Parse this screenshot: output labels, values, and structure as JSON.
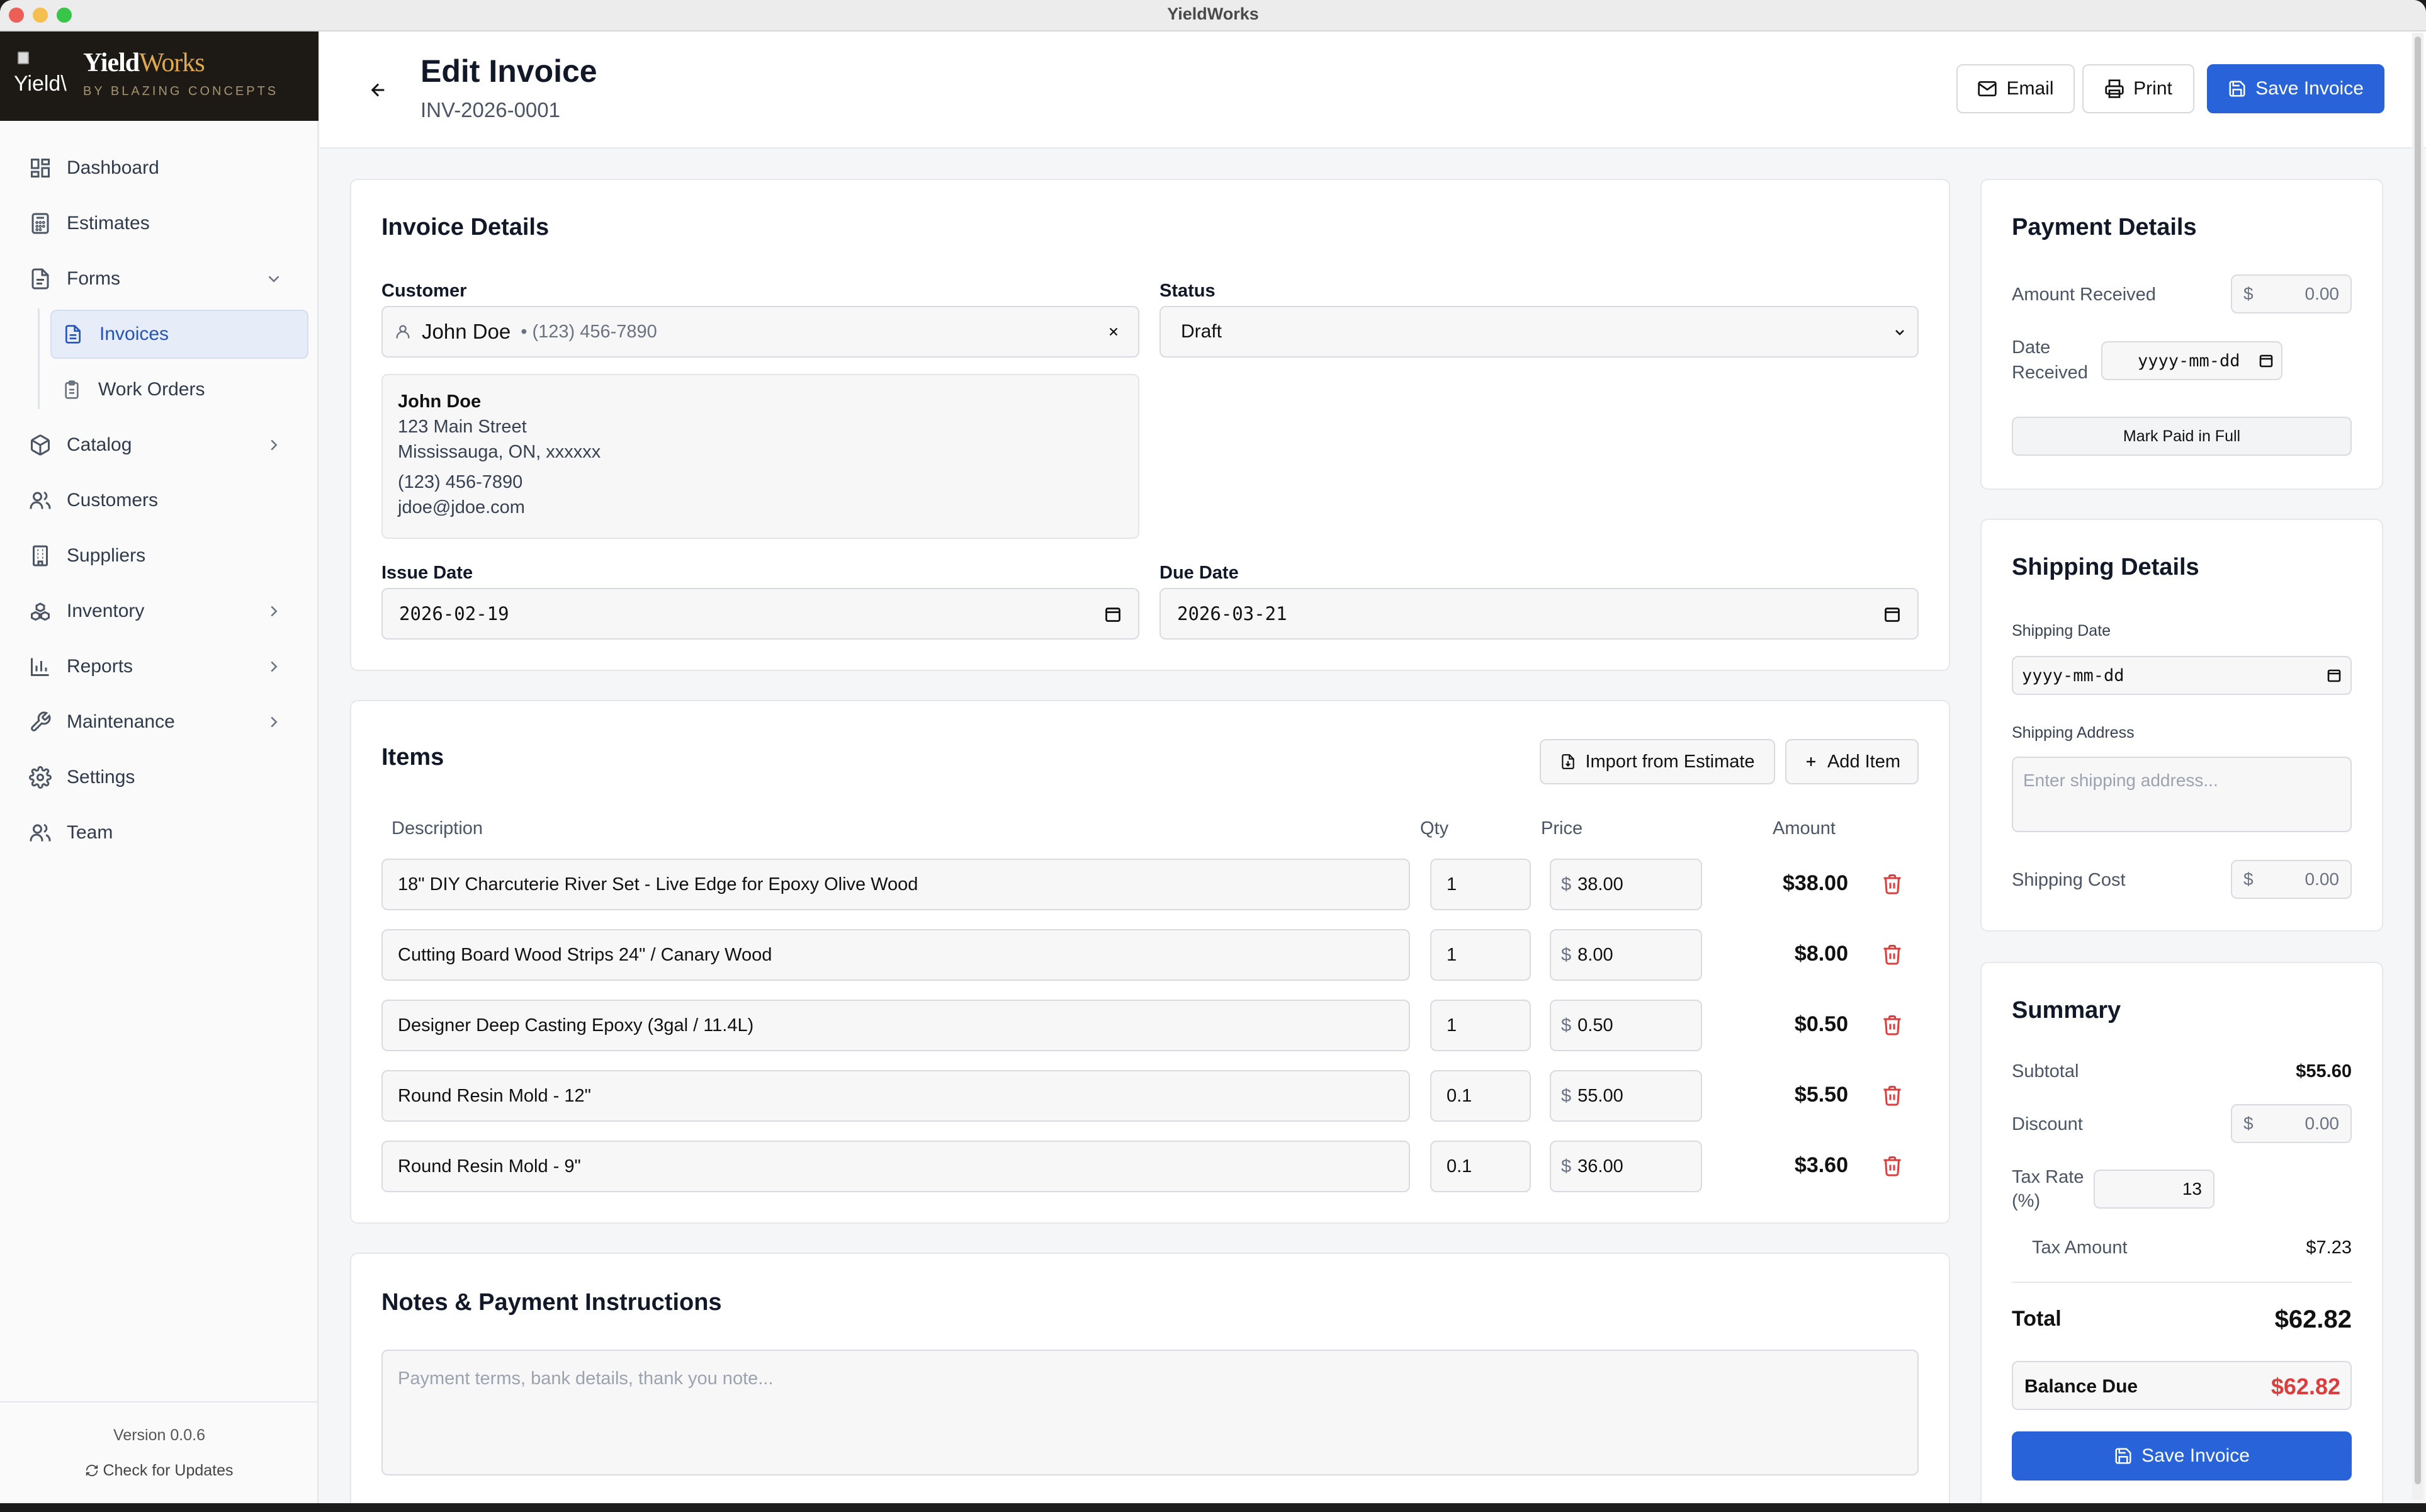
{
  "window": {
    "title": "YieldWorks"
  },
  "brand": {
    "logo_alt": "Yield\\",
    "name_main": "Yield",
    "name_accent": "Works",
    "tagline": "BY BLAZING CONCEPTS"
  },
  "sidebar": {
    "items": [
      {
        "label": "Dashboard",
        "icon": "dashboard-icon"
      },
      {
        "label": "Estimates",
        "icon": "calculator-icon"
      },
      {
        "label": "Forms",
        "icon": "file-icon",
        "expanded": true
      },
      {
        "label": "Invoices",
        "icon": "file-text-icon",
        "active": true
      },
      {
        "label": "Work Orders",
        "icon": "clipboard-icon"
      },
      {
        "label": "Catalog",
        "icon": "package-icon"
      },
      {
        "label": "Customers",
        "icon": "users-icon"
      },
      {
        "label": "Suppliers",
        "icon": "building-icon"
      },
      {
        "label": "Inventory",
        "icon": "boxes-icon"
      },
      {
        "label": "Reports",
        "icon": "bar-chart-icon"
      },
      {
        "label": "Maintenance",
        "icon": "wrench-icon"
      },
      {
        "label": "Settings",
        "icon": "gear-icon"
      },
      {
        "label": "Team",
        "icon": "team-icon"
      }
    ],
    "version": "Version 0.0.6",
    "check_updates": "Check for Updates"
  },
  "header": {
    "title": "Edit Invoice",
    "invoice_number": "INV-2026-0001",
    "email_label": "Email",
    "print_label": "Print",
    "save_label": "Save Invoice"
  },
  "invoice_details": {
    "title": "Invoice Details",
    "customer_label": "Customer",
    "customer_name": "John Doe",
    "customer_phone": "• (123) 456-7890",
    "status_label": "Status",
    "status_value": "Draft",
    "address": {
      "name": "John Doe",
      "street": "123 Main Street",
      "city": "Mississauga, ON, xxxxxx",
      "phone": "(123) 456-7890",
      "email": "jdoe@jdoe.com"
    },
    "issue_date_label": "Issue Date",
    "issue_date": "2026-02-19",
    "due_date_label": "Due Date",
    "due_date": "2026-03-21"
  },
  "items": {
    "title": "Items",
    "import_label": "Import from Estimate",
    "add_label": "Add Item",
    "columns": {
      "description": "Description",
      "qty": "Qty",
      "price": "Price",
      "amount": "Amount"
    },
    "currency": "$",
    "rows": [
      {
        "description": "18\" DIY Charcuterie River Set - Live Edge for Epoxy Olive Wood",
        "qty": "1",
        "price": "38.00",
        "amount": "$38.00"
      },
      {
        "description": "Cutting Board Wood Strips 24\" / Canary Wood",
        "qty": "1",
        "price": "8.00",
        "amount": "$8.00"
      },
      {
        "description": "Designer Deep Casting Epoxy (3gal / 11.4L)",
        "qty": "1",
        "price": "0.50",
        "amount": "$0.50"
      },
      {
        "description": "Round Resin Mold - 12\"",
        "qty": "0.1",
        "price": "55.00",
        "amount": "$5.50"
      },
      {
        "description": "Round Resin Mold - 9\"",
        "qty": "0.1",
        "price": "36.00",
        "amount": "$3.60"
      }
    ]
  },
  "notes": {
    "title": "Notes & Payment Instructions",
    "placeholder": "Payment terms, bank details, thank you note..."
  },
  "payment": {
    "title": "Payment Details",
    "amount_received_label": "Amount Received",
    "amount_received": "0.00",
    "date_received_label_1": "Date",
    "date_received_label_2": "Received",
    "date_placeholder": "yyyy-mm-dd",
    "mark_paid_label": "Mark Paid in Full"
  },
  "shipping": {
    "title": "Shipping Details",
    "date_label": "Shipping Date",
    "date_placeholder": "yyyy-mm-dd",
    "address_label": "Shipping Address",
    "address_placeholder": "Enter shipping address...",
    "cost_label": "Shipping Cost",
    "cost": "0.00"
  },
  "summary": {
    "title": "Summary",
    "subtotal_label": "Subtotal",
    "subtotal": "$55.60",
    "discount_label": "Discount",
    "discount": "0.00",
    "tax_rate_label_1": "Tax Rate",
    "tax_rate_label_2": "(%)",
    "tax_rate": "13",
    "tax_amount_label": "Tax Amount",
    "tax_amount": "$7.23",
    "total_label": "Total",
    "total": "$62.82",
    "balance_label": "Balance Due",
    "balance": "$62.82",
    "save_label": "Save Invoice"
  },
  "colors": {
    "primary": "#2863d9",
    "danger": "#dc3e3e",
    "brand_bg": "#1d1915",
    "brand_accent": "#e1a94d",
    "active_nav": "#2554b8"
  }
}
